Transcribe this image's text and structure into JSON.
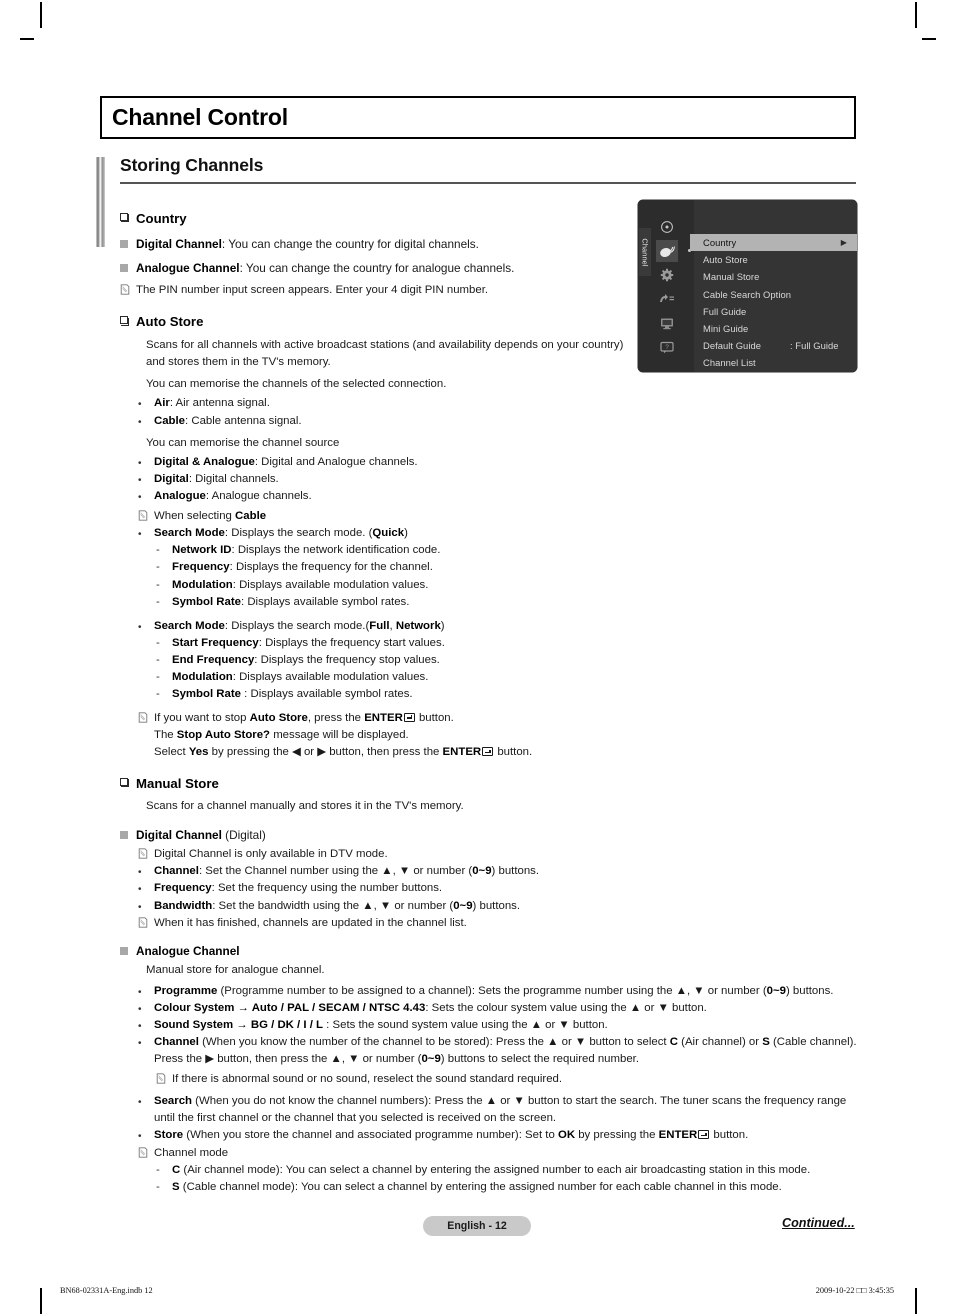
{
  "page": {
    "title": "Channel Control",
    "section_title": "Storing Channels",
    "page_label": "English - 12",
    "continued_label": "Continued...",
    "print_left": "BN68-02331A-Eng.indb   12",
    "print_right": "2009-10-22   □□ 3:45:35"
  },
  "osd": {
    "tab_label": "Channel",
    "icons": [
      {
        "name": "picture-icon"
      },
      {
        "name": "channel-antenna-icon"
      },
      {
        "name": "setup-gear-icon"
      },
      {
        "name": "input-icon"
      },
      {
        "name": "application-icon"
      },
      {
        "name": "support-icon"
      }
    ],
    "items": [
      {
        "label": "Country",
        "value": "",
        "selected": true,
        "arrow": "▶"
      },
      {
        "label": "Auto Store",
        "value": "",
        "selected": false,
        "arrow": ""
      },
      {
        "label": "Manual Store",
        "value": "",
        "selected": false,
        "arrow": ""
      },
      {
        "label": "Cable Search Option",
        "value": "",
        "selected": false,
        "arrow": ""
      },
      {
        "label": "Full Guide",
        "value": "",
        "selected": false,
        "arrow": ""
      },
      {
        "label": "Mini Guide",
        "value": "",
        "selected": false,
        "arrow": ""
      },
      {
        "label": "Default Guide",
        "value": ": Full Guide",
        "selected": false,
        "arrow": ""
      },
      {
        "label": "Channel List",
        "value": "",
        "selected": false,
        "arrow": ""
      }
    ]
  },
  "content": {
    "country_heading": "Country",
    "country_digital_label": "Digital Channel",
    "country_digital_text": ": You can change the country for digital channels.",
    "country_analogue_label": "Analogue Channel",
    "country_analogue_text": ": You can change the country for analogue channels.",
    "country_note": "The PIN number input screen appears. Enter your 4 digit PIN number.",
    "autostore_heading": "Auto Store",
    "autostore_intro": "Scans for all channels with active broadcast stations (and availability depends on your country) and stores them in the TV's memory.",
    "autostore_line1": "You can memorise the channels of the selected connection.",
    "air_label": "Air",
    "air_text": ": Air antenna signal.",
    "cable_label": "Cable",
    "cable_text": ": Cable antenna signal.",
    "autostore_line2": "You can memorise the channel source",
    "da_label": "Digital & Analogue",
    "da_text": ": Digital and Analogue channels.",
    "dig_label": "Digital",
    "dig_text": ": Digital channels.",
    "ana_label": "Analogue",
    "ana_text": ": Analogue channels.",
    "when_selecting_pre": "When selecting ",
    "when_selecting_bold": "Cable",
    "sm1_label": "Search Mode",
    "sm1_text": ": Displays the search mode. (",
    "sm1_bold": "Quick",
    "sm1_tail": ")",
    "netid_label": "Network ID",
    "netid_text": ": Displays the network identification code.",
    "freq_label": "Frequency",
    "freq_text": ": Displays the frequency for the channel.",
    "mod_label": "Modulation",
    "mod_text": ": Displays available modulation values.",
    "sym_label": "Symbol Rate",
    "sym_text": ": Displays available symbol rates.",
    "sm2_label": "Search Mode",
    "sm2_text": ": Displays the search mode.(",
    "sm2_bold1": "Full",
    "sm2_mid": ", ",
    "sm2_bold2": "Network",
    "sm2_tail": ")",
    "startfreq_label": "Start Frequency",
    "startfreq_text": ": Displays the frequency start values.",
    "endfreq_label": "End Frequency",
    "endfreq_text": ": Displays the frequency stop values.",
    "mod2_label": "Modulation",
    "mod2_text": ": Displays available modulation values.",
    "sym2_label": "Symbol Rate",
    "sym2_text": " : Displays available symbol rates.",
    "stop_note_1a": "If you want to stop ",
    "stop_note_1b": "Auto Store",
    "stop_note_1c": ", press the ",
    "stop_note_1d": "ENTER",
    "stop_note_1e": " button.",
    "stop_note_2a": "The ",
    "stop_note_2b": "Stop Auto Store?",
    "stop_note_2c": " message will be displayed.",
    "stop_note_3a": "Select ",
    "stop_note_3b": "Yes",
    "stop_note_3c": " by pressing the ◀ or ▶ button, then press the ",
    "stop_note_3d": "ENTER",
    "stop_note_3e": " button.",
    "manualstore_heading": "Manual Store",
    "manualstore_intro": "Scans for a channel manually and stores it in the TV's memory.",
    "digch_label": "Digital Channel",
    "digch_suffix": " (Digital)",
    "digch_note": "Digital Channel is only available in DTV mode.",
    "ch_label": "Channel",
    "ch_text_a": ": Set the Channel number using the ▲, ▼ or number (",
    "ch_text_b": "0~9",
    "ch_text_c": ") buttons.",
    "freq2_label": "Frequency",
    "freq2_text": ": Set the frequency using the number buttons.",
    "bw_label": "Bandwidth",
    "bw_text_a": ": Set the bandwidth using the ▲, ▼ or number (",
    "bw_text_b": "0~9",
    "bw_text_c": ") buttons.",
    "finished_note": "When it has finished, channels are updated in the channel list.",
    "anach_label": "Analogue Channel",
    "anach_intro": "Manual store for analogue channel.",
    "prog_label": "Programme",
    "prog_text_a": " (Programme number to be assigned to a channel): Sets the programme number using the ▲, ▼ or number (",
    "prog_text_b": "0~9",
    "prog_text_c": ") buttons.",
    "colour_label_a": "Colour System",
    "colour_label_b": " → ",
    "colour_label_c": "Auto / PAL / SECAM / NTSC 4.43",
    "colour_text": ": Sets the colour system value using the ▲ or ▼ button.",
    "sound_label_a": "Sound System",
    "sound_label_b": " → ",
    "sound_label_c": "BG / DK / I / L",
    "sound_text": " : Sets the sound system value using the ▲ or ▼ button.",
    "ch2_label": "Channel",
    "ch2_text_a": " (When you know the number of the channel to be stored): Press the ▲ or ▼ button to select ",
    "ch2_b1": "C",
    "ch2_text_b": " (Air channel) or ",
    "ch2_b2": "S",
    "ch2_text_c": " (Cable channel). Press the ▶ button, then press the ▲, ▼ or number (",
    "ch2_b3": "0~9",
    "ch2_text_d": ") buttons to select the required number.",
    "abnormal_note": "If there is abnormal sound or no sound, reselect the sound standard required.",
    "search_label": "Search",
    "search_text": " (When you do not know the channel numbers): Press the ▲ or ▼ button to start the search. The tuner scans the frequency range until the first channel or the channel that you selected is received on the screen.",
    "store_label": "Store",
    "store_text_a": " (When you store the channel and associated programme number): Set to ",
    "store_b": "OK",
    "store_text_b": " by pressing the ",
    "store_enter": "ENTER",
    "store_text_c": " button.",
    "chmode_note": "Channel mode",
    "cmode_c": "C",
    "cmode_c_text": " (Air channel mode): You can select a channel by entering the assigned number to each air broadcasting station in this mode.",
    "cmode_s": "S",
    "cmode_s_text": " (Cable channel mode): You can select a channel by entering the assigned number for each cable channel in this mode."
  }
}
